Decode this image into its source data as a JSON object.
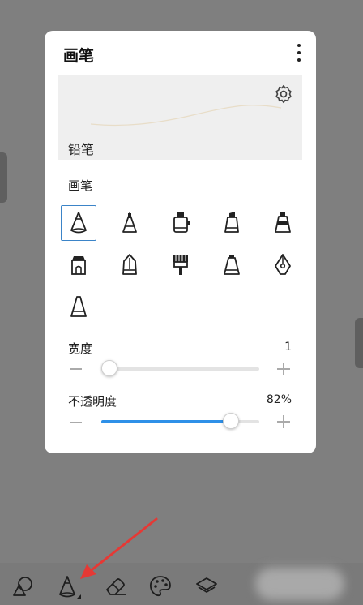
{
  "panel": {
    "title": "画笔",
    "preview_label": "铅笔",
    "section_label": "画笔",
    "brushes": [
      {
        "icon": "pencil-icon",
        "selected": true
      },
      {
        "icon": "cone-tip-icon"
      },
      {
        "icon": "marker-icon"
      },
      {
        "icon": "chisel-marker-icon"
      },
      {
        "icon": "highlighter-icon"
      },
      {
        "icon": "stamp-icon"
      },
      {
        "icon": "ink-pen-icon"
      },
      {
        "icon": "paint-brush-icon"
      },
      {
        "icon": "airbrush-icon"
      },
      {
        "icon": "fountain-pen-icon"
      },
      {
        "icon": "triangle-brush-icon"
      }
    ],
    "width": {
      "label": "宽度",
      "value": "1",
      "level": 0.05
    },
    "opacity": {
      "label": "不透明度",
      "value": "82%",
      "level": 0.82
    }
  },
  "colors": {
    "accent": "#2e90e8",
    "selected_border": "#3b84c8",
    "background": "#7f7f7f",
    "arrow": "#e53935"
  },
  "toolbar": {
    "tools": [
      "shapes-icon",
      "pencil-brush-icon",
      "eraser-icon",
      "palette-icon",
      "layers-icon"
    ],
    "active": "pencil-brush-icon"
  }
}
